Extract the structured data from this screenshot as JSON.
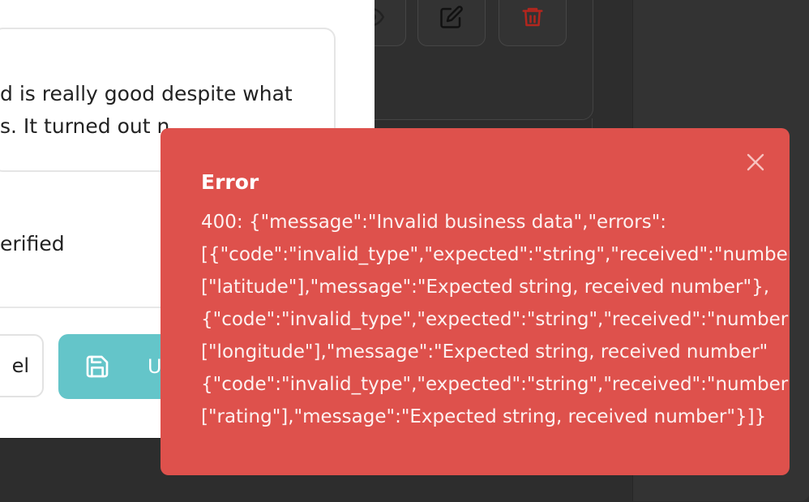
{
  "actions": {
    "view_icon": "eye-icon",
    "edit_icon": "edit-icon",
    "delete_icon": "trash-icon"
  },
  "modal": {
    "review_text_line1": "d is really good despite what",
    "review_text_line2": "s. It turned out n",
    "verified_label": "erified",
    "cancel_label": "el",
    "update_label": "Up",
    "update_icon": "save-icon"
  },
  "toast": {
    "title": "Error",
    "message": "400: {\"message\":\"Invalid business data\",\"errors\":\n[{\"code\":\"invalid_type\",\"expected\":\"string\",\"received\":\"number\n[\"latitude\"],\"message\":\"Expected string, received number\"},\n{\"code\":\"invalid_type\",\"expected\":\"string\",\"received\":\"number\n[\"longitude\"],\"message\":\"Expected string, received number\"\n{\"code\":\"invalid_type\",\"expected\":\"string\",\"received\":\"number\n[\"rating\"],\"message\":\"Expected string, received number\"}]}",
    "close_icon": "close-icon",
    "color": "#de514c"
  },
  "colors": {
    "accent": "#64c5c9",
    "delete": "#b3261e"
  }
}
